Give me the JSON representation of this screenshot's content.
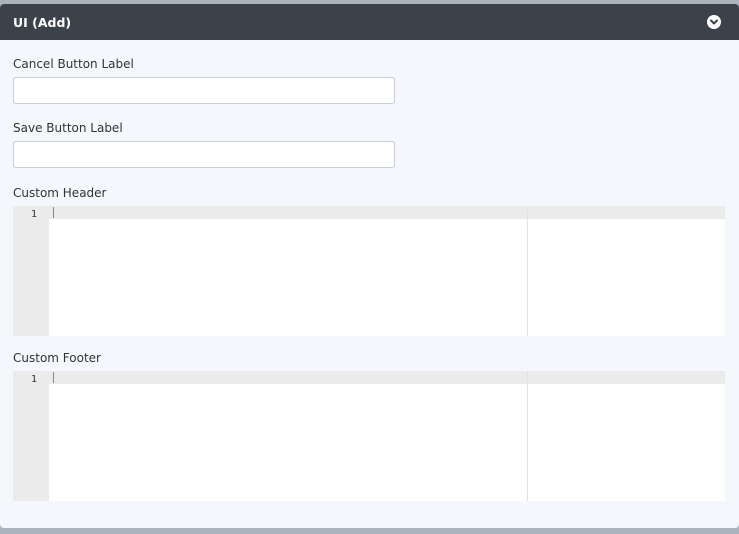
{
  "panel": {
    "title": "UI (Add)",
    "collapse_icon": "chevron-down-circle-icon"
  },
  "fields": {
    "cancel_label": "Cancel Button Label",
    "cancel_value": "",
    "save_label": "Save Button Label",
    "save_value": "",
    "custom_header_label": "Custom Header",
    "custom_footer_label": "Custom Footer"
  },
  "editors": {
    "header_line_number": "1",
    "footer_line_number": "1"
  },
  "colors": {
    "header_bg": "#3b4249",
    "panel_bg": "#f4f8fc",
    "gutter_bg": "#ebebeb"
  }
}
